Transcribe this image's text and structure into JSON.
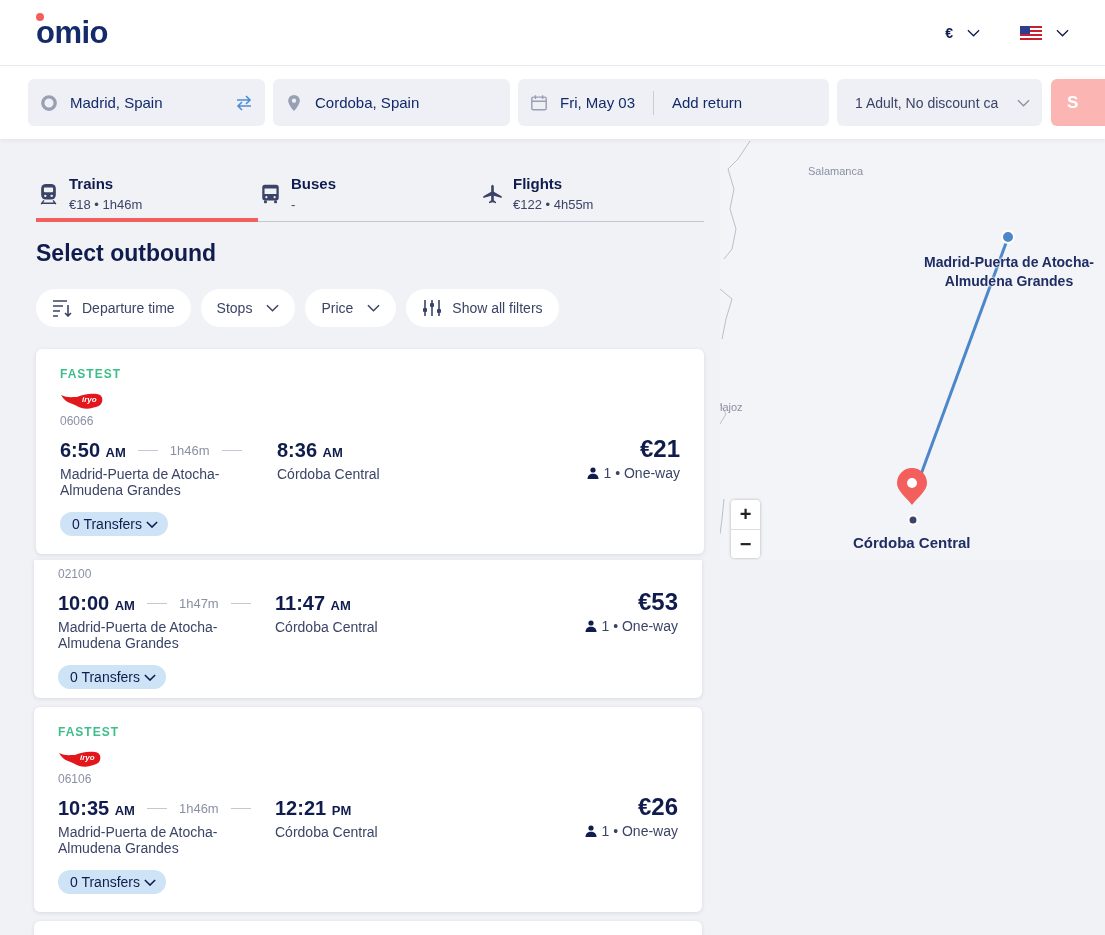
{
  "header": {
    "logo": "omio",
    "currency": "€"
  },
  "search": {
    "origin": "Madrid, Spain",
    "destination": "Cordoba, Spain",
    "date": "Fri, May 03",
    "return_placeholder": "Add return",
    "passengers": "1 Adult, No discount ca",
    "button": "S"
  },
  "tabs": [
    {
      "kind": "train",
      "label": "Trains",
      "detail": "€18 • 1h46m",
      "selected": true
    },
    {
      "kind": "bus",
      "label": "Buses",
      "detail": "-",
      "selected": false
    },
    {
      "kind": "plane",
      "label": "Flights",
      "detail": "€122 • 4h55m",
      "selected": false
    }
  ],
  "heading": "Select outbound",
  "filters": [
    {
      "kind": "sort",
      "label": "Departure time"
    },
    {
      "kind": "dropdown",
      "label": "Stops"
    },
    {
      "kind": "dropdown",
      "label": "Price"
    },
    {
      "kind": "filters",
      "label": "Show all filters"
    }
  ],
  "results": [
    {
      "badge": "FASTEST",
      "logo": "iryo",
      "code": "06066",
      "departure": "6:50",
      "departure_period": "AM",
      "duration": "1h46m",
      "arrival": "8:36",
      "arrival_period": "AM",
      "from": "Madrid-Puerta de Atocha-Almudena Grandes",
      "to": "Córdoba Central",
      "price": "€21",
      "passengers": "1 • One-way",
      "transfers": "0 Transfers"
    },
    {
      "code": "02100",
      "departure": "10:00",
      "departure_period": "AM",
      "duration": "1h47m",
      "arrival": "11:47",
      "arrival_period": "AM",
      "from": "Madrid-Puerta de Atocha-Almudena Grandes",
      "to": "Córdoba Central",
      "price": "€53",
      "passengers": "1 • One-way",
      "transfers": "0 Transfers"
    },
    {
      "badge": "FASTEST",
      "logo": "iryo",
      "code": "06106",
      "departure": "10:35",
      "departure_period": "AM",
      "duration": "1h46m",
      "arrival": "12:21",
      "arrival_period": "PM",
      "from": "Madrid-Puerta de Atocha-Almudena Grandes",
      "to": "Córdoba Central",
      "price": "€26",
      "passengers": "1 • One-way",
      "transfers": "0 Transfers"
    }
  ],
  "map": {
    "places": [
      "Salamanca",
      "lajoz"
    ],
    "origin_label": "Madrid-Puerta de Atocha-Almudena Grandes",
    "destination_label": "Córdoba Central",
    "zoom_in": "+",
    "zoom_out": "−"
  }
}
